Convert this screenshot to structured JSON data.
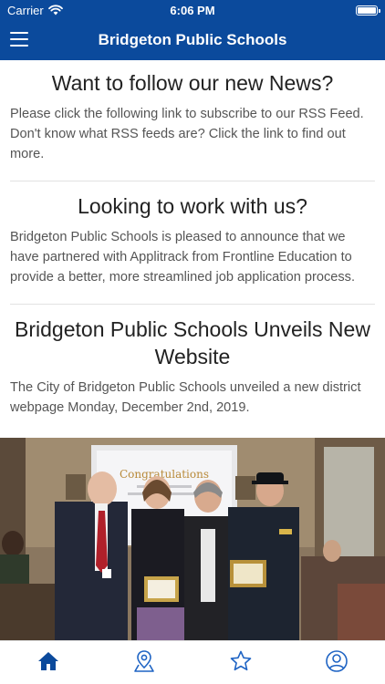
{
  "status_bar": {
    "carrier": "Carrier",
    "time": "6:06 PM"
  },
  "nav": {
    "title": "Bridgeton Public Schools"
  },
  "articles": [
    {
      "title": "Want to follow our new News?",
      "body": "Please click the following link to subscribe to our RSS Feed. Don't know what RSS feeds are? Click the link to find out more."
    },
    {
      "title": "Looking to work with us?",
      "body": "Bridgeton Public Schools is pleased to announce that we have partnered with Applitrack from Frontline Education to provide a better, more streamlined job application process."
    },
    {
      "title": "Bridgeton Public Schools Unveils New Website",
      "body": "The City of Bridgeton Public Schools unveiled a new district webpage Monday, December 2nd, 2019."
    }
  ],
  "photo": {
    "screen_heading": "Congratulations"
  },
  "tabs": [
    {
      "icon": "home-icon",
      "active": true
    },
    {
      "icon": "map-pin-icon",
      "active": false
    },
    {
      "icon": "star-icon",
      "active": false
    },
    {
      "icon": "user-icon",
      "active": false
    }
  ],
  "colors": {
    "brand": "#0b4a9c",
    "tab_active": "#0b4a9c",
    "tab_inactive": "#1f64c4"
  }
}
